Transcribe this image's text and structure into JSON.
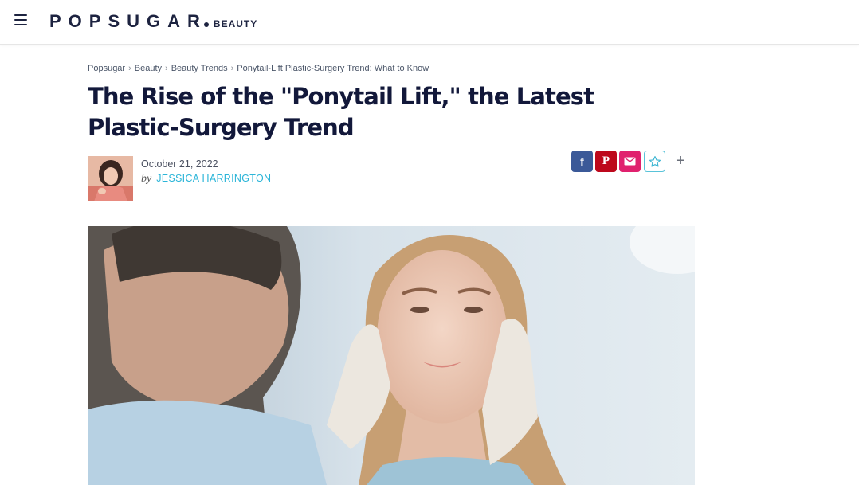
{
  "header": {
    "logo_main": "POPSUGAR",
    "logo_section": "BEAUTY"
  },
  "breadcrumb": [
    {
      "label": "Popsugar"
    },
    {
      "label": "Beauty"
    },
    {
      "label": "Beauty Trends"
    },
    {
      "label": "Ponytail-Lift Plastic-Surgery Trend: What to Know"
    }
  ],
  "breadcrumb_sep": "›",
  "article": {
    "title": "The Rise of the \"Ponytail Lift,\" the Latest Plastic-Surgery Trend",
    "date": "October 21, 2022",
    "by": "by",
    "author": "JESSICA HARRINGTON"
  },
  "share": {
    "facebook_glyph": "f",
    "pinterest_glyph": "P",
    "plus_glyph": "+"
  },
  "colors": {
    "brand": "#1d2340",
    "author_link": "#2bb5d8",
    "facebook": "#3b5998",
    "pinterest": "#bd081c",
    "email": "#e0216e"
  },
  "icons": [
    "hamburger-menu-icon",
    "facebook-icon",
    "pinterest-icon",
    "mail-icon",
    "star-icon",
    "plus-icon"
  ]
}
